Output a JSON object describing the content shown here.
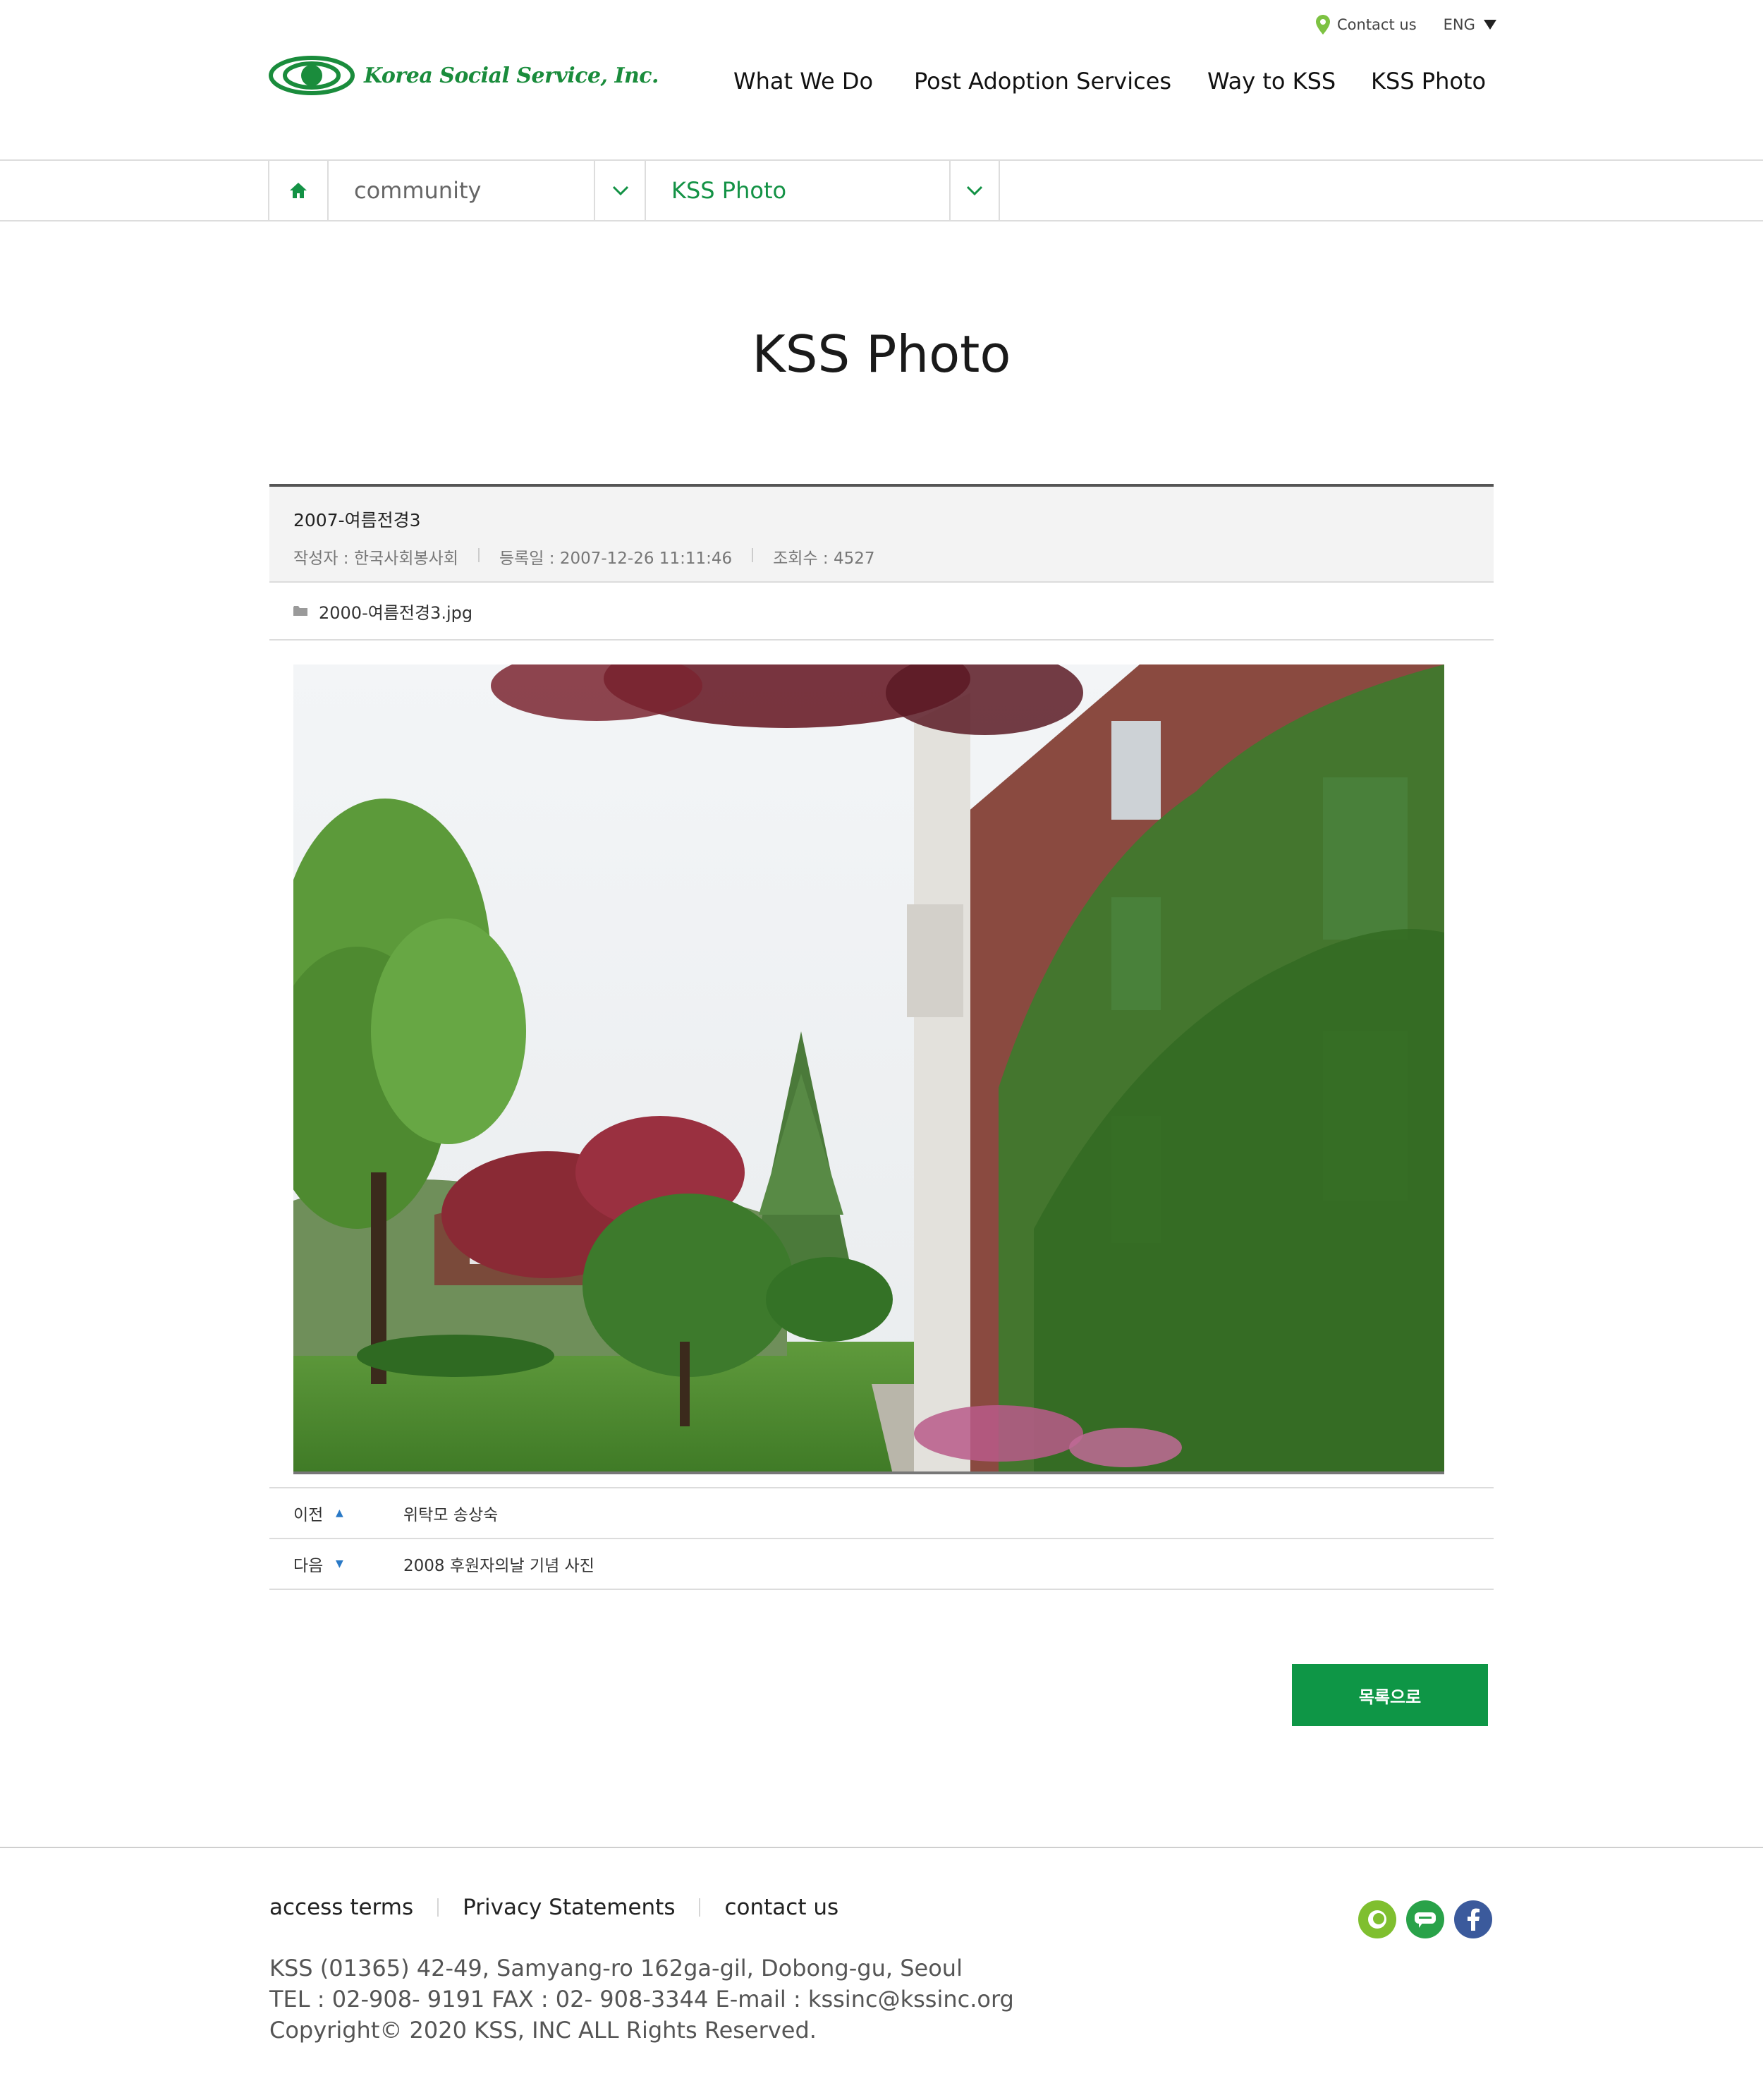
{
  "utility": {
    "contact_label": "Contact us",
    "lang_label": "ENG"
  },
  "header": {
    "logo_text": "Korea Social Service, Inc.",
    "nav": [
      "What We Do",
      "Post Adoption Services",
      "Way to KSS",
      "KSS Photo"
    ]
  },
  "location": {
    "depth1": "community",
    "depth2": "KSS Photo"
  },
  "page": {
    "title": "KSS Photo"
  },
  "post": {
    "title": "2007-여름전경3",
    "author": "작성자 : 한국사회봉사회",
    "date": "등록일 : 2007-12-26 11:11:46",
    "views": "조회수 : 4527",
    "attachment": "2000-여름전경3.jpg"
  },
  "navigation": {
    "prev_label": "이전",
    "prev_title": "위탁모 송상숙",
    "next_label": "다음",
    "next_title": "2008 후원자의날 기념 사진"
  },
  "buttons": {
    "list_label": "목록으로"
  },
  "footer": {
    "links": [
      "access terms",
      "Privacy Statements",
      "contact us"
    ],
    "address": "KSS (01365) 42-49, Samyang-ro 162ga-gil, Dobong-gu, Seoul",
    "contact": "TEL : 02-908- 9191 FAX : 02- 908-3344 E-mail : kssinc@kssinc.org",
    "copyright": "Copyright© 2020 KSS, INC ALL Rights Reserved."
  },
  "colors": {
    "brand_green": "#0e9646",
    "location_active": "#139245",
    "arrow_blue": "#2a79c6"
  },
  "icons": {
    "contact": "map-pin-icon",
    "home": "home-icon",
    "dropdown": "chevron-down-icon",
    "attachment": "folder-icon",
    "prev": "caret-up-icon",
    "next": "caret-down-icon",
    "sns": [
      "kakaostory-icon",
      "kakaotalk-icon",
      "facebook-icon"
    ]
  }
}
